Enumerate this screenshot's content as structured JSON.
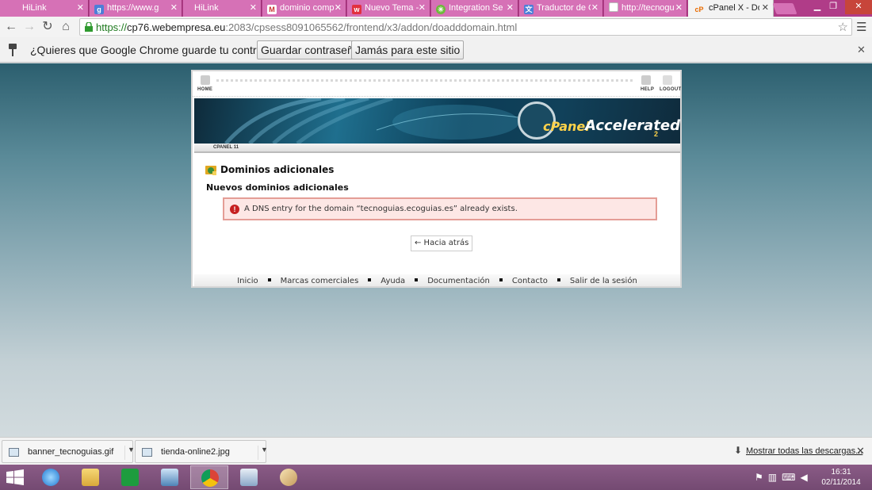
{
  "browser": {
    "tabs": [
      {
        "label": "HiLink",
        "icon": "hilink-icon",
        "active": false
      },
      {
        "label": "https://www.g",
        "icon": "google-icon",
        "active": false
      },
      {
        "label": "HiLink",
        "icon": "hilink-icon",
        "active": false
      },
      {
        "label": "dominio comp",
        "icon": "gmail-icon",
        "active": false
      },
      {
        "label": "Nuevo Tema -",
        "icon": "forum-icon",
        "active": false
      },
      {
        "label": "Integration Ser",
        "icon": "loading-icon",
        "active": false
      },
      {
        "label": "Traductor de G",
        "icon": "translate-icon",
        "active": false
      },
      {
        "label": "http://tecnogu",
        "icon": "page-icon",
        "active": false
      },
      {
        "label": "cPanel X - Dom",
        "icon": "cpanel-icon",
        "active": true
      }
    ],
    "url": {
      "scheme": "https://",
      "host": "cp76.webempresa.eu",
      "path": ":2083/cpsess8091065562/frontend/x3/addon/doadddomain.html"
    },
    "infobar": {
      "message": "¿Quieres que Google Chrome guarde tu contraseña?",
      "save_label": "Guardar contraseña",
      "never_label": "Jamás para este sitio"
    }
  },
  "cpanel": {
    "topnav": {
      "home": "HOME",
      "help": "HELP",
      "logout": "LOGOUT"
    },
    "banner": {
      "logo": "cPanel",
      "tagline": "Accelerated",
      "version": "2"
    },
    "breadcrumb": "CPANEL 11",
    "page_title": "Dominios adicionales",
    "subtitle": "Nuevos dominios adicionales",
    "alert": "A DNS entry for the domain “tecnoguias.ecoguias.es” already exists.",
    "back_label": "← Hacia atrás",
    "footer_links": [
      "Inicio",
      "Marcas comerciales",
      "Ayuda",
      "Documentación",
      "Contacto",
      "Salir de la sesión"
    ]
  },
  "downloads": {
    "items": [
      {
        "name": "banner_tecnoguias.gif"
      },
      {
        "name": "tienda-online2.jpg"
      }
    ],
    "show_all": "Mostrar todas las descargas..."
  },
  "taskbar": {
    "time": "16:31",
    "date": "02/11/2014",
    "apps": [
      "internet-explorer-icon",
      "file-explorer-icon",
      "store-icon",
      "control-panel-icon",
      "chrome-icon",
      "notepad-icon",
      "paint-icon"
    ]
  },
  "colors": {
    "tabstrip": "#b03c88",
    "taskbar": "#7e517b",
    "alert_bg": "#fde7e5",
    "alert_border": "#e49d96"
  }
}
